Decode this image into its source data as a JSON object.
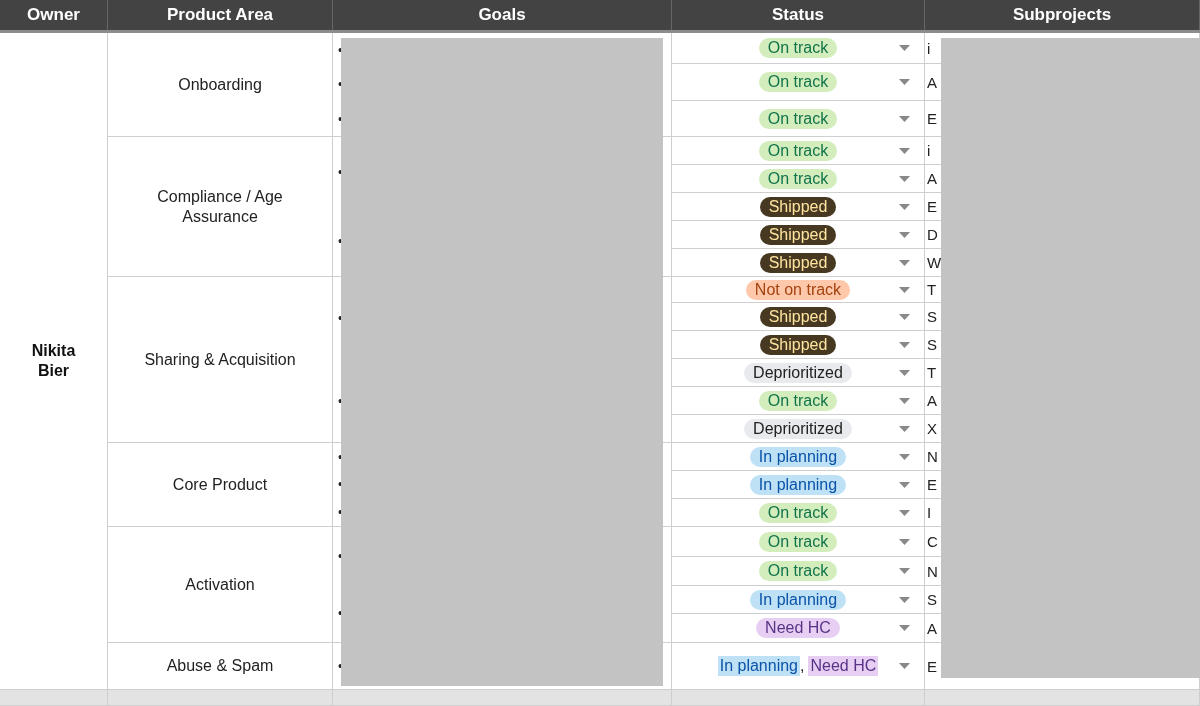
{
  "table": {
    "columns": [
      "Owner",
      "Product Area",
      "Goals",
      "Status",
      "Subprojects"
    ],
    "owner": "Nikita\nBier",
    "areas": [
      {
        "name": "Onboarding",
        "goal_marks": [
          "•",
          "•",
          "•"
        ],
        "rows": [
          {
            "statuses": [
              {
                "label": "On track",
                "kind": "on_track"
              }
            ],
            "subproject": "i"
          },
          {
            "statuses": [
              {
                "label": "On track",
                "kind": "on_track"
              }
            ],
            "subproject": "A"
          },
          {
            "statuses": [
              {
                "label": "On track",
                "kind": "on_track"
              }
            ],
            "subproject": "E"
          }
        ]
      },
      {
        "name": "Compliance / Age Assurance",
        "goal_marks": [
          "•",
          "•"
        ],
        "rows": [
          {
            "statuses": [
              {
                "label": "On track",
                "kind": "on_track"
              }
            ],
            "subproject": "i"
          },
          {
            "statuses": [
              {
                "label": "On track",
                "kind": "on_track"
              }
            ],
            "subproject": "A"
          },
          {
            "statuses": [
              {
                "label": "Shipped",
                "kind": "shipped"
              }
            ],
            "subproject": "E"
          },
          {
            "statuses": [
              {
                "label": "Shipped",
                "kind": "shipped"
              }
            ],
            "subproject": "D"
          },
          {
            "statuses": [
              {
                "label": "Shipped",
                "kind": "shipped"
              }
            ],
            "subproject": "W"
          }
        ]
      },
      {
        "name": "Sharing & Acquisition",
        "goal_marks": [
          "•",
          "•"
        ],
        "rows": [
          {
            "statuses": [
              {
                "label": "Not on track",
                "kind": "not_on_track"
              }
            ],
            "subproject": "T"
          },
          {
            "statuses": [
              {
                "label": "Shipped",
                "kind": "shipped"
              }
            ],
            "subproject": "S"
          },
          {
            "statuses": [
              {
                "label": "Shipped",
                "kind": "shipped"
              }
            ],
            "subproject": "S"
          },
          {
            "statuses": [
              {
                "label": "Deprioritized",
                "kind": "deprioritized"
              }
            ],
            "subproject": "T"
          },
          {
            "statuses": [
              {
                "label": "On track",
                "kind": "on_track"
              }
            ],
            "subproject": "A"
          },
          {
            "statuses": [
              {
                "label": "Deprioritized",
                "kind": "deprioritized"
              }
            ],
            "subproject": "X"
          }
        ]
      },
      {
        "name": "Core Product",
        "goal_marks": [
          "•",
          "•",
          "•"
        ],
        "rows": [
          {
            "statuses": [
              {
                "label": "In planning",
                "kind": "in_planning"
              }
            ],
            "subproject": "N"
          },
          {
            "statuses": [
              {
                "label": "In planning",
                "kind": "in_planning"
              }
            ],
            "subproject": "E"
          },
          {
            "statuses": [
              {
                "label": "On track",
                "kind": "on_track"
              }
            ],
            "subproject": "I"
          }
        ]
      },
      {
        "name": "Activation",
        "goal_marks": [
          "•",
          "•"
        ],
        "rows": [
          {
            "statuses": [
              {
                "label": "On track",
                "kind": "on_track"
              }
            ],
            "subproject": "C"
          },
          {
            "statuses": [
              {
                "label": "On track",
                "kind": "on_track"
              }
            ],
            "subproject": "N"
          },
          {
            "statuses": [
              {
                "label": "In planning",
                "kind": "in_planning"
              }
            ],
            "subproject": "S"
          },
          {
            "statuses": [
              {
                "label": "Need HC",
                "kind": "need_hc"
              }
            ],
            "subproject": "A"
          }
        ]
      },
      {
        "name": "Abuse & Spam",
        "goal_marks": [
          "•"
        ],
        "rows": [
          {
            "statuses": [
              {
                "label": "In planning",
                "kind": "in_planning"
              },
              {
                "label": "Need HC",
                "kind": "need_hc"
              }
            ],
            "separator": ",",
            "subproject": "E"
          }
        ]
      }
    ]
  }
}
